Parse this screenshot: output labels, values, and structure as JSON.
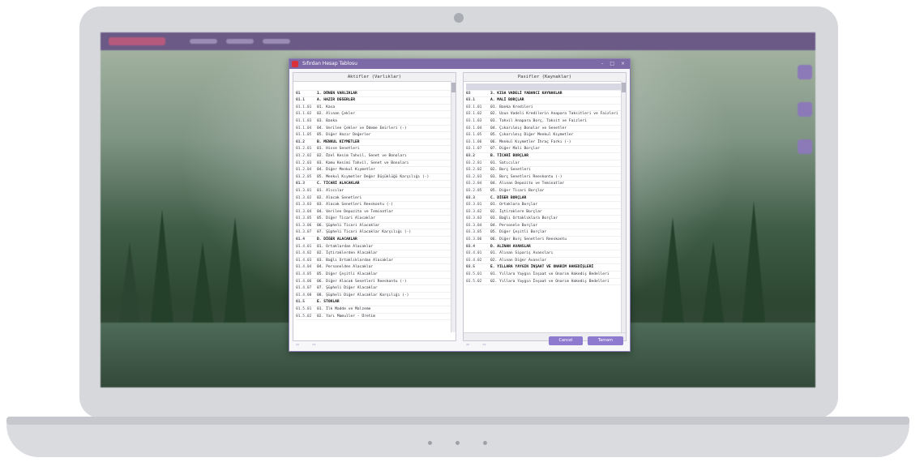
{
  "dialog": {
    "title": "Sıfırdan Hesap Tablosu",
    "window_controls": "– □ ×",
    "left_panel": {
      "header": "Aktifler (Varlıklar)",
      "rows": [
        {
          "code": "",
          "label": ""
        },
        {
          "code": "01",
          "label": "1. DÖNEN VARLIKLAR",
          "hdr": true
        },
        {
          "code": "01.1",
          "label": "A. HAZIR DEĞERLER",
          "hdr": true
        },
        {
          "code": "01.1.01",
          "label": "01. Kasa"
        },
        {
          "code": "01.1.02",
          "label": "02. Alınan Çekler"
        },
        {
          "code": "01.1.03",
          "label": "03. Banka"
        },
        {
          "code": "01.1.04",
          "label": "04. Verilen Çekler ve Ödeme Emirleri (-)"
        },
        {
          "code": "01.1.05",
          "label": "05. Diğer Hazır Değerler"
        },
        {
          "code": "01.2",
          "label": "B. MENKUL KIYMETLER",
          "hdr": true
        },
        {
          "code": "01.2.01",
          "label": "01. Hisse Senetleri"
        },
        {
          "code": "01.2.02",
          "label": "02. Özel Kesim Tahvil, Senet ve Bonoları"
        },
        {
          "code": "01.2.03",
          "label": "03. Kamu Kesimi Tahvil, Senet ve Bonoları"
        },
        {
          "code": "01.2.04",
          "label": "04. Diğer Menkul Kıymetler"
        },
        {
          "code": "01.2.05",
          "label": "05. Menkul Kıymetler Değer Düşüklüğü Karşılığı (-)"
        },
        {
          "code": "01.3",
          "label": "C. TİCARİ ALACAKLAR",
          "hdr": true
        },
        {
          "code": "01.3.01",
          "label": "01. Alıcılar"
        },
        {
          "code": "01.3.02",
          "label": "02. Alacak Senetleri"
        },
        {
          "code": "01.3.03",
          "label": "03. Alacak Senetleri Reeskontu (-)"
        },
        {
          "code": "01.3.04",
          "label": "04. Verilen Depozito ve Teminatlar"
        },
        {
          "code": "01.3.05",
          "label": "05. Diğer Ticari Alacaklar"
        },
        {
          "code": "01.3.06",
          "label": "06. Şüpheli Ticari Alacaklar"
        },
        {
          "code": "01.3.07",
          "label": "07. Şüpheli Ticari Alacaklar Karşılığı (-)"
        },
        {
          "code": "01.4",
          "label": "D. DİĞER ALACAKLAR",
          "hdr": true
        },
        {
          "code": "01.4.01",
          "label": "01. Ortaklardan Alacaklar"
        },
        {
          "code": "01.4.02",
          "label": "02. İştiraklerden Alacaklar"
        },
        {
          "code": "01.4.03",
          "label": "03. Bağlı Ortaklıklardan Alacaklar"
        },
        {
          "code": "01.4.04",
          "label": "04. Personelden Alacaklar"
        },
        {
          "code": "01.4.05",
          "label": "05. Diğer Çeşitli Alacaklar"
        },
        {
          "code": "01.4.06",
          "label": "06. Diğer Alacak Senetleri Reeskontu (-)"
        },
        {
          "code": "01.4.07",
          "label": "07. Şüpheli Diğer Alacaklar"
        },
        {
          "code": "01.4.08",
          "label": "08. Şüpheli Diğer Alacaklar Karşılığı (-)"
        },
        {
          "code": "01.5",
          "label": "E. STOKLAR",
          "hdr": true
        },
        {
          "code": "01.5.01",
          "label": "01. İlk Madde ve Malzeme"
        },
        {
          "code": "01.5.02",
          "label": "02. Yarı Mamuller - Üretim"
        }
      ]
    },
    "right_panel": {
      "header": "Pasifler (Kaynaklar)",
      "rows": [
        {
          "code": "",
          "label": "",
          "sel": true
        },
        {
          "code": "03",
          "label": "3. KISA VADELİ YABANCI KAYNAKLAR",
          "hdr": true
        },
        {
          "code": "03.1",
          "label": "A. MALİ BORÇLAR",
          "hdr": true
        },
        {
          "code": "03.1.01",
          "label": "01. Banka Kredileri"
        },
        {
          "code": "03.1.02",
          "label": "02. Uzun Vadeli Kredilerin Anapara Taksitleri ve Faizleri"
        },
        {
          "code": "03.1.03",
          "label": "03. Tahvil Anapara Borç, Taksit ve Faizleri"
        },
        {
          "code": "03.1.04",
          "label": "04. Çıkarılmış Bonolar ve Senetler"
        },
        {
          "code": "03.1.05",
          "label": "05. Çıkarılmış Diğer Menkul Kıymetler"
        },
        {
          "code": "03.1.06",
          "label": "06. Menkul Kıymetler İhraç Farkı (-)"
        },
        {
          "code": "03.1.07",
          "label": "07. Diğer Mali Borçlar"
        },
        {
          "code": "03.2",
          "label": "B. TİCARİ BORÇLAR",
          "hdr": true
        },
        {
          "code": "03.2.01",
          "label": "01. Satıcılar"
        },
        {
          "code": "03.2.02",
          "label": "02. Borç Senetleri"
        },
        {
          "code": "03.2.03",
          "label": "03. Borç Senetleri Reeskontu (-)"
        },
        {
          "code": "03.2.04",
          "label": "04. Alınan Depozito ve Teminatlar"
        },
        {
          "code": "03.2.05",
          "label": "05. Diğer Ticari Borçlar"
        },
        {
          "code": "03.3",
          "label": "C. DİĞER BORÇLAR",
          "hdr": true
        },
        {
          "code": "03.3.01",
          "label": "01. Ortaklara Borçlar"
        },
        {
          "code": "03.3.02",
          "label": "02. İştiraklere Borçlar"
        },
        {
          "code": "03.3.03",
          "label": "03. Bağlı Ortaklıklara Borçlar"
        },
        {
          "code": "03.3.04",
          "label": "04. Personele Borçlar"
        },
        {
          "code": "03.3.05",
          "label": "05. Diğer Çeşitli Borçlar"
        },
        {
          "code": "03.3.06",
          "label": "06. Diğer Borç Senetleri Reeskontu"
        },
        {
          "code": "03.4",
          "label": "D. ALINAN AVANSLAR",
          "hdr": true
        },
        {
          "code": "03.4.01",
          "label": "01. Alınan Sipariş Avansları"
        },
        {
          "code": "03.4.02",
          "label": "02. Alınan Diğer Avanslar"
        },
        {
          "code": "03.5",
          "label": "E. YILLARA YAYGIN İNŞAAT VE ONARIM HAKEDİŞLERİ",
          "hdr": true
        },
        {
          "code": "03.5.01",
          "label": "01. Yıllara Yaygın İnşaat ve Onarım Hakediş Bedelleri"
        },
        {
          "code": "03.5.02",
          "label": "02. Yıllara Yaygın İnşaat ve Onarım Hakediş Bedelleri"
        }
      ]
    },
    "buttons": {
      "cancel": "Cancel",
      "ok": "Tamam"
    },
    "nav": {
      "left": "⇦ ⇨",
      "right": "⇦ ⇨"
    }
  }
}
